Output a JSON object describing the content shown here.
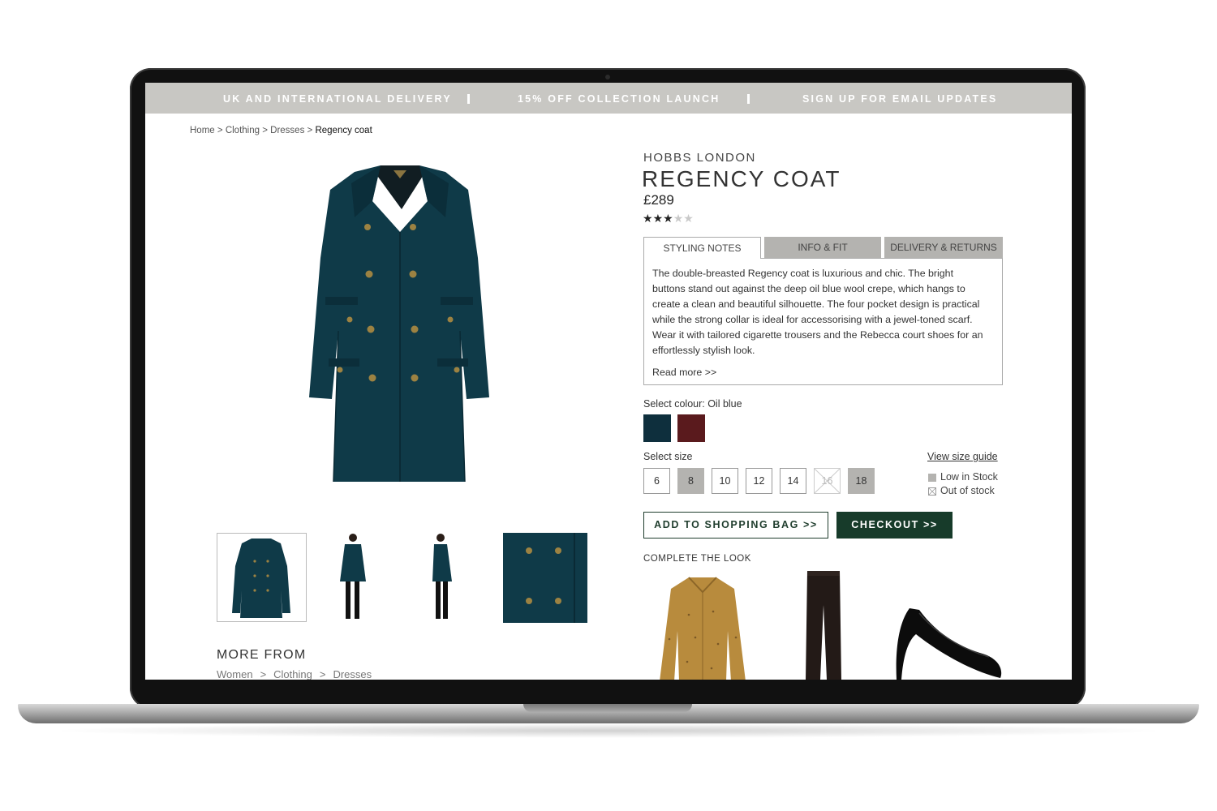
{
  "promo_bar": {
    "items": [
      "UK AND INTERNATIONAL DELIVERY",
      "15% OFF COLLECTION LAUNCH",
      "SIGN UP FOR EMAIL UPDATES"
    ]
  },
  "breadcrumb": {
    "items": [
      "Home",
      "Clothing",
      "Dresses"
    ],
    "separator": ">",
    "current": "Regency coat"
  },
  "product": {
    "brand": "HOBBS LONDON",
    "title": "REGENCY COAT",
    "price": "£289",
    "rating": {
      "value": 3,
      "max": 5,
      "filled_glyph": "★",
      "empty_glyph": "★"
    },
    "image_color": "#0f3a48"
  },
  "tabs": {
    "items": [
      "STYLING NOTES",
      "INFO & FIT",
      "DELIVERY & RETURNS"
    ],
    "active": "STYLING NOTES",
    "styling_notes": "The double-breasted Regency coat is luxurious and chic. The bright buttons stand out against the deep oil blue wool crepe, which hangs to create a clean and beautiful silhouette. The four pocket design is practical while the strong collar is ideal for accessorising with a jewel-toned scarf. Wear it with tailored cigarette trousers and the Rebecca court shoes for an effortlessly stylish look.",
    "read_more": "Read more >>"
  },
  "colour": {
    "label": "Select colour: Oil blue",
    "swatches": [
      {
        "name": "Oil blue",
        "hex": "#0e2f3d",
        "selected": true
      },
      {
        "name": "Burgundy",
        "hex": "#5a1a1d",
        "selected": false
      }
    ]
  },
  "size": {
    "label": "Select size",
    "guide_link": "View size guide",
    "options": [
      {
        "value": "6",
        "state": "available"
      },
      {
        "value": "8",
        "state": "low"
      },
      {
        "value": "10",
        "state": "available"
      },
      {
        "value": "12",
        "state": "available"
      },
      {
        "value": "14",
        "state": "available"
      },
      {
        "value": "16",
        "state": "out"
      },
      {
        "value": "18",
        "state": "low"
      }
    ],
    "legend": {
      "low": "Low in Stock",
      "out": "Out of stock"
    }
  },
  "actions": {
    "add_to_bag": "ADD TO SHOPPING BAG >>",
    "checkout": "CHECKOUT  >>"
  },
  "complete_the_look": {
    "heading": "COMPLETE THE LOOK",
    "items": [
      "blouse",
      "trousers",
      "heels"
    ]
  },
  "more_from": {
    "heading": "MORE FROM",
    "crumbs": [
      "Women",
      "Clothing",
      "Dresses"
    ]
  },
  "colors": {
    "promo_bar": "#c8c7c3",
    "accent_green": "#173b2a",
    "tab_inactive": "#b4b3b0"
  }
}
